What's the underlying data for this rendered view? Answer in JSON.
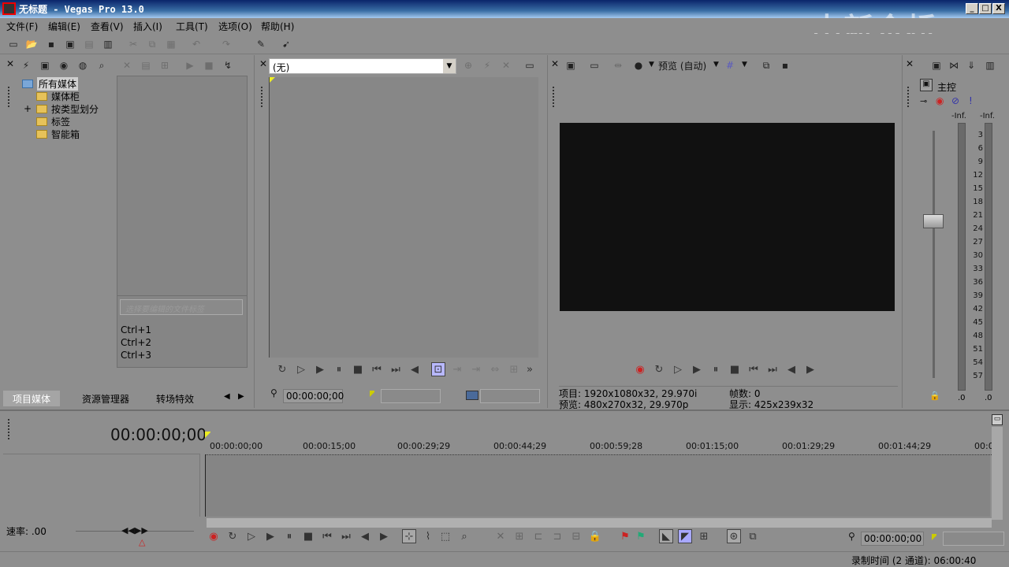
{
  "window": {
    "title": "无标题 - Vegas Pro 13.0",
    "watermark": "中新金桥",
    "minimize": "_",
    "maximize": "□",
    "close": "X"
  },
  "menu": [
    "文件(F)",
    "编辑(E)",
    "查看(V)",
    "插入(I)",
    "工具(T)",
    "选项(O)",
    "帮助(H)"
  ],
  "media_panel": {
    "tree": [
      {
        "label": "所有媒体",
        "expand": ""
      },
      {
        "label": "媒体柜",
        "expand": ""
      },
      {
        "label": "按类型划分",
        "expand": "+"
      },
      {
        "label": "标签",
        "expand": ""
      },
      {
        "label": "智能箱",
        "expand": ""
      }
    ],
    "tag_placeholder": "选择要编辑的文件标签",
    "shortcuts": [
      "Ctrl+1",
      "Ctrl+2",
      "Ctrl+3"
    ],
    "tabs": [
      "项目媒体",
      "资源管理器",
      "转场特效"
    ]
  },
  "trimmer": {
    "selector_value": "(无)",
    "timecode": "00:00:00;00"
  },
  "preview": {
    "mode_label": "预览 (自动)",
    "project_label": "项目:",
    "project_value": "1920x1080x32, 29.970i",
    "preview_label": "预览:",
    "preview_value": "480x270x32, 29.970p",
    "frame_label": "帧数:",
    "frame_value": "0",
    "display_label": "显示:",
    "display_value": "425x239x32"
  },
  "master": {
    "label": "主控",
    "inf_left": "-Inf.",
    "inf_right": "-Inf.",
    "scale": [
      "3",
      "6",
      "9",
      "12",
      "15",
      "18",
      "21",
      "24",
      "27",
      "30",
      "33",
      "36",
      "39",
      "42",
      "45",
      "48",
      "51",
      "54",
      "57"
    ],
    "bottom_left": ".0",
    "bottom_right": ".0"
  },
  "timeline": {
    "timecode": "00:00:00;00",
    "ruler": [
      "00:00:00;00",
      "00:00:15;00",
      "00:00:29;29",
      "00:00:44;29",
      "00:00:59;28",
      "00:01:15;00",
      "00:01:29;29",
      "00:01:44;29",
      "00:0"
    ],
    "rate": "速率: .00",
    "transport_timecode": "00:00:00;00"
  },
  "status": {
    "record_time": "录制时间 (2 通道): 06:00:40"
  },
  "colors": {
    "panel": "#8e8e8e",
    "title_gradient_start": "#0a246a",
    "accent_red": "#cc2222",
    "screen": "#111111"
  }
}
